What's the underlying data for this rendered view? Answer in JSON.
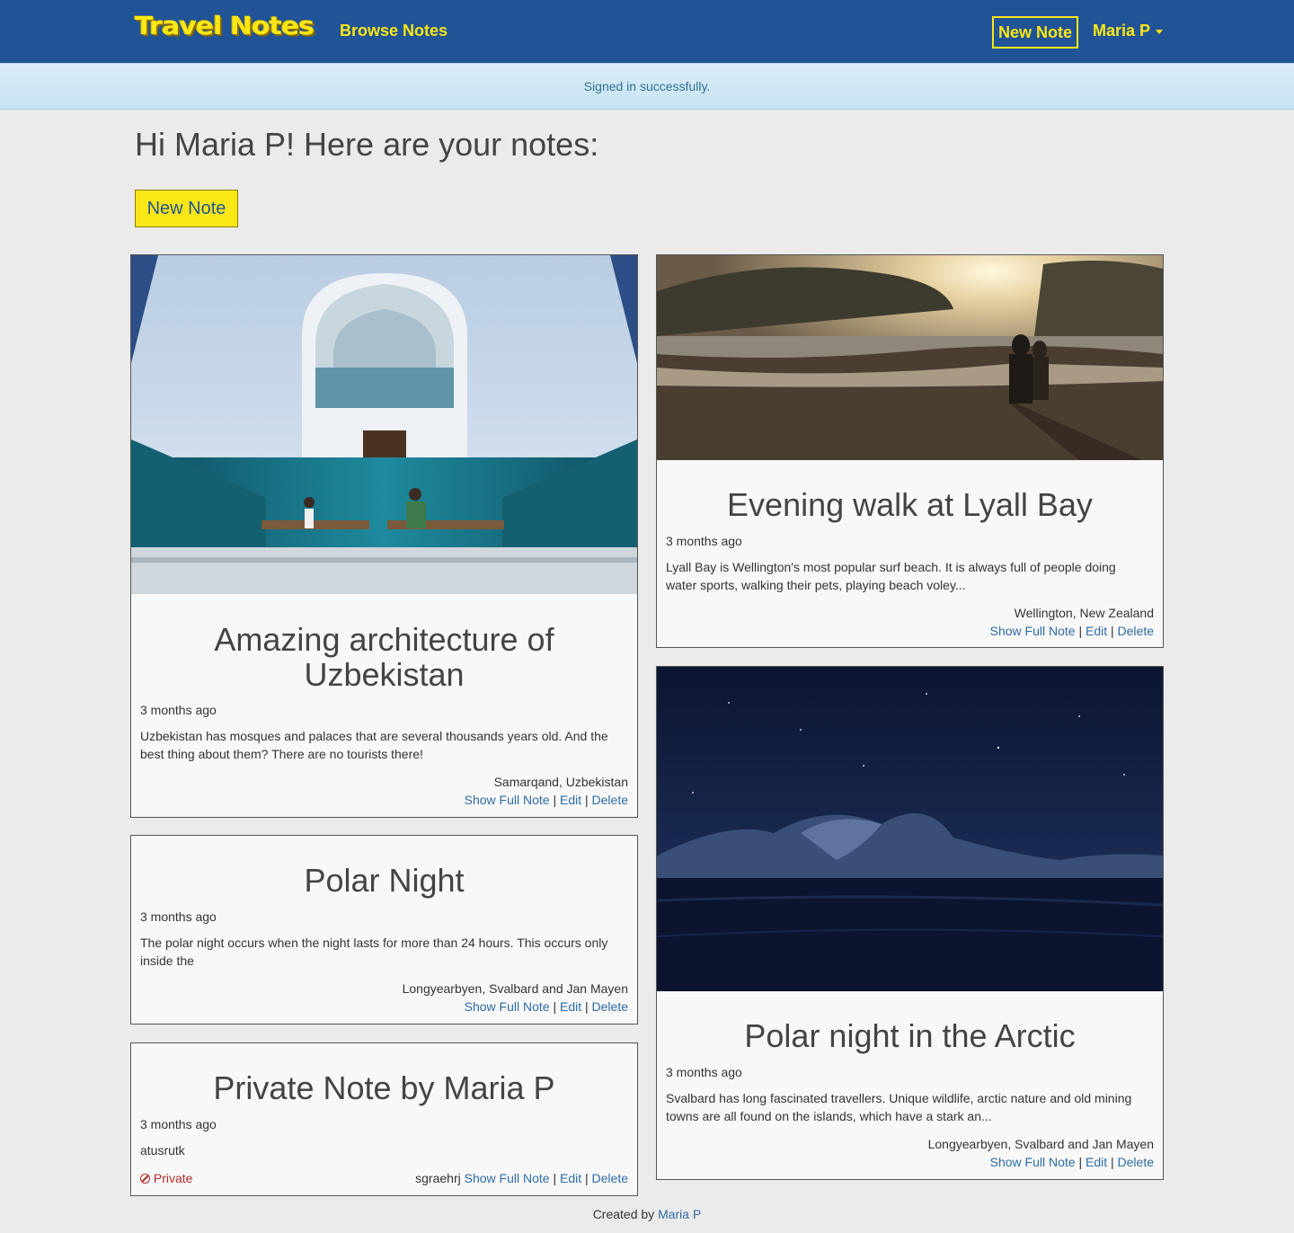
{
  "nav": {
    "brand": "Travel Notes",
    "browse": "Browse Notes",
    "new_note": "New Note",
    "user": "Maria P"
  },
  "flash": "Signed in successfully.",
  "greeting": "Hi Maria P! Here are your notes:",
  "new_note_button": "New Note",
  "notes": [
    {
      "title": "Amazing architecture of Uzbekistan",
      "ago": "3 months ago",
      "description": "Uzbekistan has mosques and palaces that are several thousands years old. And the best thing about them? There are no tourists there!",
      "location": "Samarqand, Uzbekistan",
      "show": "Show Full Note",
      "edit": "Edit",
      "delete": "Delete",
      "photo": "mosque-interior-photo"
    },
    {
      "title": "Polar Night",
      "ago": "3 months ago",
      "description": "The polar night occurs when the night lasts for more than 24 hours. This occurs only inside the",
      "location": "Longyearbyen, Svalbard and Jan Mayen",
      "show": "Show Full Note",
      "edit": "Edit",
      "delete": "Delete"
    },
    {
      "title": "Private Note by Maria P",
      "ago": "3 months ago",
      "description": "atusrutk",
      "private_label": "Private",
      "location": "sgraehrj",
      "show": "Show Full Note",
      "edit": "Edit",
      "delete": "Delete"
    },
    {
      "title": "Evening walk at Lyall Bay",
      "ago": "3 months ago",
      "description": "Lyall Bay is Wellington's most popular surf beach. It is always full of people doing water sports, walking their pets, playing beach voley...",
      "location": "Wellington, New Zealand",
      "show": "Show Full Note",
      "edit": "Edit",
      "delete": "Delete",
      "photo": "beach-sunset-photo"
    },
    {
      "title": "Polar night in the Arctic",
      "ago": "3 months ago",
      "description": "Svalbard has long fascinated travellers. Unique wildlife, arctic nature and old mining towns are all found on the islands, which have a stark an...",
      "location": "Longyearbyen, Svalbard and Jan Mayen",
      "show": "Show Full Note",
      "edit": "Edit",
      "delete": "Delete",
      "photo": "arctic-night-photo"
    }
  ],
  "footer": {
    "prefix": "Created by",
    "author": "Maria P"
  },
  "colors": {
    "navbar": "#215496",
    "accent": "#fbe716",
    "link": "#2e6da4",
    "private": "#b52c2c"
  }
}
